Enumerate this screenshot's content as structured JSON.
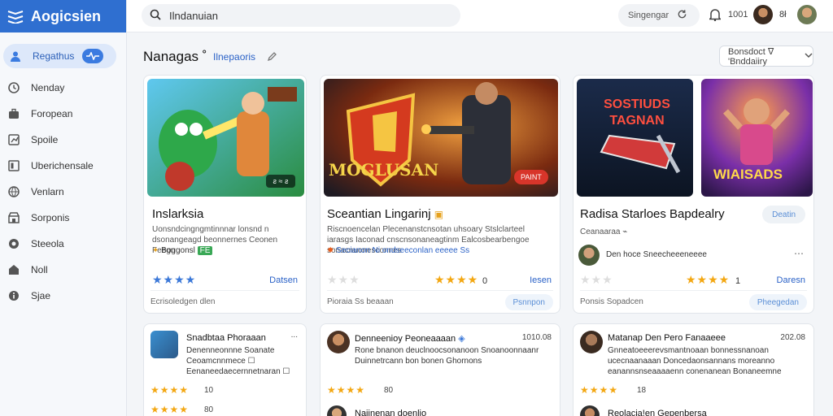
{
  "app": {
    "name": "Aogicsien"
  },
  "search": {
    "value": "Ilndanuian"
  },
  "topbar": {
    "sort_label": "Singengar",
    "notification_count": "1001",
    "small_label": "8ł"
  },
  "sidebar": {
    "active": {
      "label": "Regathus"
    },
    "items": [
      {
        "label": "Nenday",
        "icon": "clock-icon"
      },
      {
        "label": "Foropean",
        "icon": "briefcase-icon"
      },
      {
        "label": "Spoile",
        "icon": "chart-icon"
      },
      {
        "label": "Uberichensale",
        "icon": "library-icon"
      },
      {
        "label": "Venlarn",
        "icon": "globe-icon"
      },
      {
        "label": "Sorponis",
        "icon": "store-icon"
      },
      {
        "label": "Steeola",
        "icon": "circle-icon"
      },
      {
        "label": "Noll",
        "icon": "home-icon"
      },
      {
        "label": "Sjae",
        "icon": "info-icon"
      }
    ]
  },
  "header": {
    "title": "Nanagas ˚",
    "link": "Ilnepaoris",
    "filter_label": "Bonsdoct ᐁ 'Bnddaiiry"
  },
  "games": [
    {
      "title": "Inslarksia",
      "desc": "Uonsndcingngmtinnnar lonsnd n dsonangeagd beonnernes Ceonen Feegn",
      "meta": "Boggonsl",
      "meta_badge": "FE",
      "stars": "★★★★",
      "rating_text": "",
      "action": "Datsen",
      "footer": "Ecrisoledgen dlen",
      "footer_btn": "",
      "image_badge": "ƨ ≈ ƨ",
      "image_banner": "ꓲꓲꓲꓲꓲꓲ"
    },
    {
      "title": "Sceantian Lingarinj",
      "desc": "Riscnoencelan Plecenanstcnsotan uhsoary Stslclarteel iarasgs Iaconad cnscnsonaneagtinm Ealcosbearbengoe sonacnuonesconnes",
      "meta": "Secianon Ni ondseeconlan eeeee Ss",
      "meta_badge": "",
      "stars": "★★★★",
      "rating_text": "0",
      "action": "Iesen",
      "footer": "Pioraia Ss beaaan",
      "footer_btn": "Psnnpon",
      "image_badge": "PAINT",
      "image_banner": "MOGLUSAN"
    },
    {
      "title": "Radisa Starloes Bapdealry",
      "desc": "Ceanaaraa",
      "meta": "Den hoce Sneecheeeneeee",
      "meta_badge": "",
      "stars": "★★★★",
      "rating_text": "1",
      "action": "Daresn",
      "footer": "Ponsis Sopadcen",
      "footer_btn": "Pheegedan",
      "image_badge": "",
      "image_banner": "SOSTIUDS TAGNAN",
      "image_banner_2": "WIAISADS",
      "top_btn": "Deatin"
    }
  ],
  "reviews": [
    {
      "name": "Snadbtaa Phoraaan",
      "time": "...",
      "text": "Denenneonnne Soanate Ceoamcnnmece ☐ Eenaneedaecernnetnaran ☐",
      "stars1": "★★★★",
      "count1": "10",
      "stars2": "★★★★",
      "count2": "80"
    },
    {
      "name": "Denneenioy Peoneaaaan",
      "time": "1010.08",
      "text": "Rone bnanon deuclnoocsonanoon Snoanoonnaanr Duinnetrcann bon bonen Ghornons",
      "stars1": "★★★★",
      "count1": "80",
      "stars2": "★★★★",
      "count2": "",
      "extra": "Naiinenan doenlio"
    },
    {
      "name": "Matanap Den Pero Fanaaeee",
      "time": "202.08",
      "text": "Gnneatoeeerevsmantnoaan bonnessnanoan ucecnaanaaan Doncedaonsannans moreanno eanannsnseaaaaenn conenanean Bonaneemne",
      "stars1": "★★★★",
      "count1": "18",
      "stars2": "",
      "count2": "",
      "extra": "Reolacia!en Gepenbersa"
    }
  ]
}
